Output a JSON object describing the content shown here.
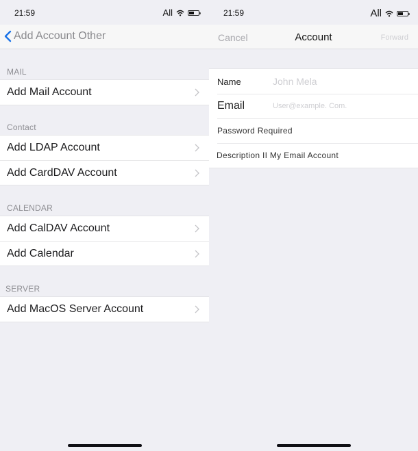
{
  "left_screen": {
    "status": {
      "time": "21:59",
      "carrier": "All",
      "wifi_icon": "wifi-icon",
      "battery_icon": "battery-icon"
    },
    "nav": {
      "back_icon": "chevron-left-icon",
      "back_label": "Add Account Other"
    },
    "sections": [
      {
        "header": "MAIL",
        "items": [
          {
            "label": "Add Mail Account"
          }
        ]
      },
      {
        "header": "Contact",
        "items": [
          {
            "label": "Add LDAP Account"
          },
          {
            "label": "Add CardDAV Account"
          }
        ]
      },
      {
        "header": "CALENDAR",
        "items": [
          {
            "label": "Add CalDAV Account"
          },
          {
            "label": "Add Calendar"
          }
        ]
      },
      {
        "header": "SERVER",
        "items": [
          {
            "label": "Add MacOS Server Account"
          }
        ]
      }
    ],
    "row_icon": "chevron-right-icon"
  },
  "right_screen": {
    "status": {
      "time": "21:59",
      "carrier": "All",
      "wifi_icon": "wifi-icon",
      "battery_icon": "battery-icon"
    },
    "nav": {
      "cancel_label": "Cancel",
      "title": "Account",
      "forward_label": "Forward"
    },
    "form": {
      "name_label": "Name",
      "name_placeholder": "John Mela",
      "email_label": "Email",
      "email_placeholder": "User@example. Com.",
      "password_label": "Password Required",
      "description_label": "Description II My Email Account"
    }
  },
  "colors": {
    "accent": "#1a73e8",
    "background": "#efeff4",
    "header_text": "#8e8e93"
  }
}
